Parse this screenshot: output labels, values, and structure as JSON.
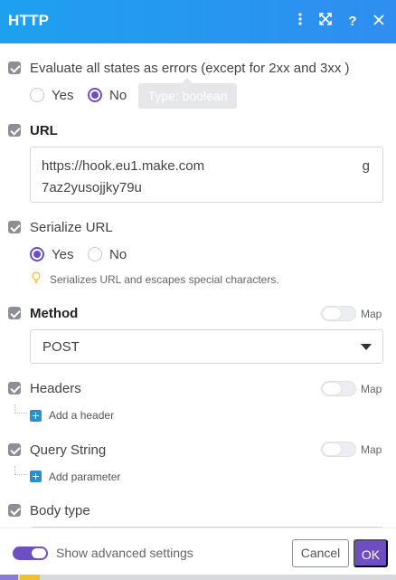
{
  "header": {
    "title": "HTTP",
    "icons": [
      "more-vertical-icon",
      "expand-icon",
      "help-icon",
      "close-icon"
    ],
    "background": "#2a95ef"
  },
  "evaluate_errors": {
    "label": "Evaluate all states as errors (except for 2xx and 3xx )",
    "options": [
      "Yes",
      "No"
    ],
    "selected": "No",
    "tooltip": "Type: boolean"
  },
  "url": {
    "label": "URL",
    "line1_start": "https://hook.eu1.make.com",
    "line1_end": "g",
    "line2": "7az2yusojjky79u"
  },
  "serialize_url": {
    "label": "Serialize URL",
    "options": [
      "Yes",
      "No"
    ],
    "selected": "Yes",
    "hint": "Serializes URL and escapes special characters."
  },
  "method": {
    "label": "Method",
    "map_label": "Map",
    "value": "POST"
  },
  "headers": {
    "label": "Headers",
    "map_label": "Map",
    "add_label": "Add a header"
  },
  "query_string": {
    "label": "Query String",
    "map_label": "Map",
    "add_label": "Add parameter"
  },
  "body_type": {
    "label": "Body type"
  },
  "footer": {
    "advanced_label": "Show advanced settings",
    "cancel_label": "Cancel",
    "ok_label": "OK"
  },
  "colors": {
    "accent": "#6d4fc2",
    "header": "#2a95ef",
    "add_button": "#2a8fcb"
  }
}
